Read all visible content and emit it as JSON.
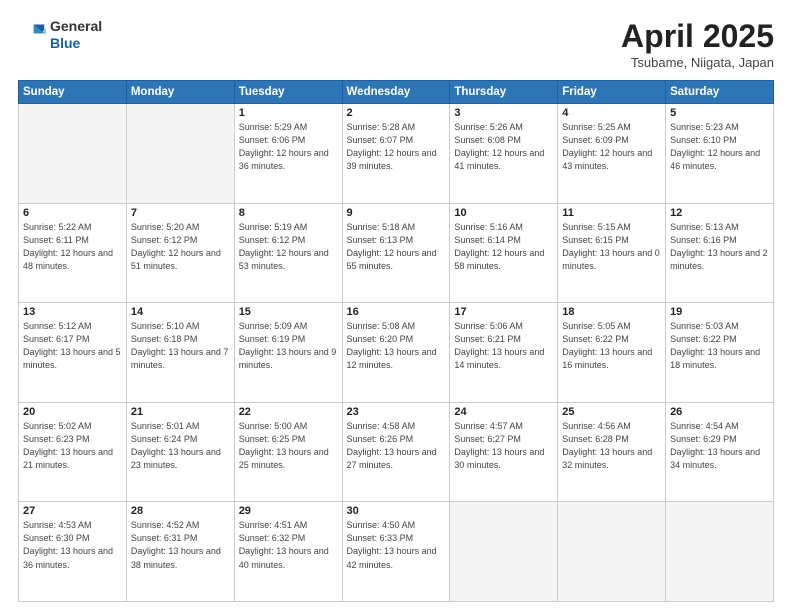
{
  "header": {
    "logo_general": "General",
    "logo_blue": "Blue",
    "title": "April 2025",
    "subtitle": "Tsubame, Niigata, Japan"
  },
  "weekdays": [
    "Sunday",
    "Monday",
    "Tuesday",
    "Wednesday",
    "Thursday",
    "Friday",
    "Saturday"
  ],
  "weeks": [
    [
      {
        "day": "",
        "info": ""
      },
      {
        "day": "",
        "info": ""
      },
      {
        "day": "1",
        "info": "Sunrise: 5:29 AM\nSunset: 6:06 PM\nDaylight: 12 hours and 36 minutes."
      },
      {
        "day": "2",
        "info": "Sunrise: 5:28 AM\nSunset: 6:07 PM\nDaylight: 12 hours and 39 minutes."
      },
      {
        "day": "3",
        "info": "Sunrise: 5:26 AM\nSunset: 6:08 PM\nDaylight: 12 hours and 41 minutes."
      },
      {
        "day": "4",
        "info": "Sunrise: 5:25 AM\nSunset: 6:09 PM\nDaylight: 12 hours and 43 minutes."
      },
      {
        "day": "5",
        "info": "Sunrise: 5:23 AM\nSunset: 6:10 PM\nDaylight: 12 hours and 46 minutes."
      }
    ],
    [
      {
        "day": "6",
        "info": "Sunrise: 5:22 AM\nSunset: 6:11 PM\nDaylight: 12 hours and 48 minutes."
      },
      {
        "day": "7",
        "info": "Sunrise: 5:20 AM\nSunset: 6:12 PM\nDaylight: 12 hours and 51 minutes."
      },
      {
        "day": "8",
        "info": "Sunrise: 5:19 AM\nSunset: 6:12 PM\nDaylight: 12 hours and 53 minutes."
      },
      {
        "day": "9",
        "info": "Sunrise: 5:18 AM\nSunset: 6:13 PM\nDaylight: 12 hours and 55 minutes."
      },
      {
        "day": "10",
        "info": "Sunrise: 5:16 AM\nSunset: 6:14 PM\nDaylight: 12 hours and 58 minutes."
      },
      {
        "day": "11",
        "info": "Sunrise: 5:15 AM\nSunset: 6:15 PM\nDaylight: 13 hours and 0 minutes."
      },
      {
        "day": "12",
        "info": "Sunrise: 5:13 AM\nSunset: 6:16 PM\nDaylight: 13 hours and 2 minutes."
      }
    ],
    [
      {
        "day": "13",
        "info": "Sunrise: 5:12 AM\nSunset: 6:17 PM\nDaylight: 13 hours and 5 minutes."
      },
      {
        "day": "14",
        "info": "Sunrise: 5:10 AM\nSunset: 6:18 PM\nDaylight: 13 hours and 7 minutes."
      },
      {
        "day": "15",
        "info": "Sunrise: 5:09 AM\nSunset: 6:19 PM\nDaylight: 13 hours and 9 minutes."
      },
      {
        "day": "16",
        "info": "Sunrise: 5:08 AM\nSunset: 6:20 PM\nDaylight: 13 hours and 12 minutes."
      },
      {
        "day": "17",
        "info": "Sunrise: 5:06 AM\nSunset: 6:21 PM\nDaylight: 13 hours and 14 minutes."
      },
      {
        "day": "18",
        "info": "Sunrise: 5:05 AM\nSunset: 6:22 PM\nDaylight: 13 hours and 16 minutes."
      },
      {
        "day": "19",
        "info": "Sunrise: 5:03 AM\nSunset: 6:22 PM\nDaylight: 13 hours and 18 minutes."
      }
    ],
    [
      {
        "day": "20",
        "info": "Sunrise: 5:02 AM\nSunset: 6:23 PM\nDaylight: 13 hours and 21 minutes."
      },
      {
        "day": "21",
        "info": "Sunrise: 5:01 AM\nSunset: 6:24 PM\nDaylight: 13 hours and 23 minutes."
      },
      {
        "day": "22",
        "info": "Sunrise: 5:00 AM\nSunset: 6:25 PM\nDaylight: 13 hours and 25 minutes."
      },
      {
        "day": "23",
        "info": "Sunrise: 4:58 AM\nSunset: 6:26 PM\nDaylight: 13 hours and 27 minutes."
      },
      {
        "day": "24",
        "info": "Sunrise: 4:57 AM\nSunset: 6:27 PM\nDaylight: 13 hours and 30 minutes."
      },
      {
        "day": "25",
        "info": "Sunrise: 4:56 AM\nSunset: 6:28 PM\nDaylight: 13 hours and 32 minutes."
      },
      {
        "day": "26",
        "info": "Sunrise: 4:54 AM\nSunset: 6:29 PM\nDaylight: 13 hours and 34 minutes."
      }
    ],
    [
      {
        "day": "27",
        "info": "Sunrise: 4:53 AM\nSunset: 6:30 PM\nDaylight: 13 hours and 36 minutes."
      },
      {
        "day": "28",
        "info": "Sunrise: 4:52 AM\nSunset: 6:31 PM\nDaylight: 13 hours and 38 minutes."
      },
      {
        "day": "29",
        "info": "Sunrise: 4:51 AM\nSunset: 6:32 PM\nDaylight: 13 hours and 40 minutes."
      },
      {
        "day": "30",
        "info": "Sunrise: 4:50 AM\nSunset: 6:33 PM\nDaylight: 13 hours and 42 minutes."
      },
      {
        "day": "",
        "info": ""
      },
      {
        "day": "",
        "info": ""
      },
      {
        "day": "",
        "info": ""
      }
    ]
  ]
}
